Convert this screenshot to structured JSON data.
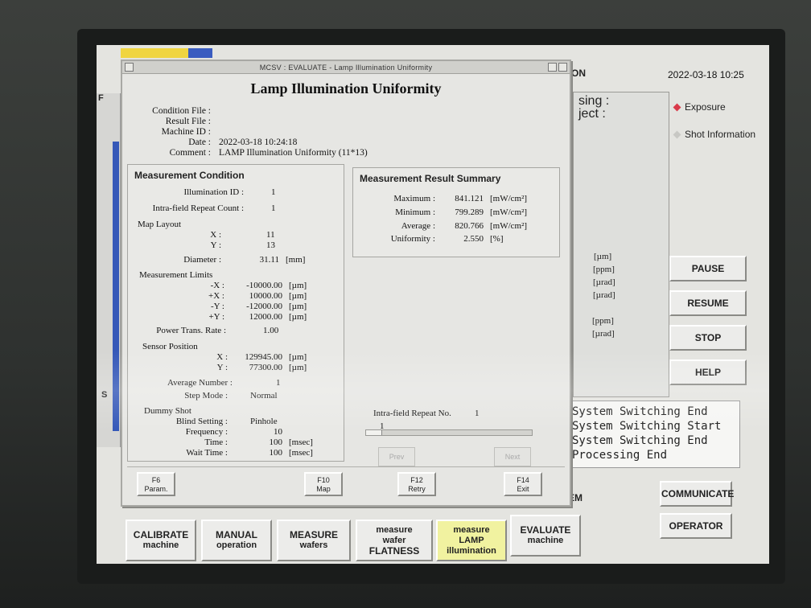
{
  "app": {
    "title_partial": "ON",
    "datetime": "2022-03-18 10:25",
    "panel_labels": [
      "sing :",
      "ject :"
    ],
    "units": [
      "[µm]",
      "[ppm]",
      "[µrad]",
      "[µrad]",
      "[ppm]",
      "[µrad]"
    ],
    "side_options": [
      {
        "label": "Exposure",
        "color": "#d93a4a"
      },
      {
        "label": "Shot Information",
        "color": "#c8c8c4"
      }
    ],
    "side_buttons": [
      "PAUSE",
      "RESUME",
      "STOP",
      "HELP"
    ],
    "log_lines": [
      "System Switching End",
      "System Switching Start",
      "System Switching End",
      " Processing End"
    ],
    "em_label": "EM",
    "right_buttons": [
      "COMMUNICATE",
      "OPERATOR"
    ],
    "left_strip_labels": [
      "F",
      "S"
    ],
    "bottom_buttons": [
      {
        "line1": "CALIBRATE",
        "line2": "machine"
      },
      {
        "line1": "MANUAL",
        "line2": "operation"
      },
      {
        "line1": "MEASURE",
        "line2": "wafers"
      },
      {
        "line1": "measure",
        "line2": "wafer",
        "line3": "FLATNESS"
      },
      {
        "line1": "measure",
        "line2": "LAMP",
        "line3": "illumination"
      },
      {
        "line1": "EVALUATE",
        "line2": "machine"
      }
    ]
  },
  "dialog": {
    "window_title": "MCSV : EVALUATE - Lamp Illumination Uniformity",
    "heading": "Lamp Illumination Uniformity",
    "meta": [
      {
        "k": "Condition File :",
        "v": ""
      },
      {
        "k": "Result File :",
        "v": ""
      },
      {
        "k": "Machine ID :",
        "v": ""
      },
      {
        "k": "Date :",
        "v": "2022-03-18 10:24:18"
      },
      {
        "k": "Comment :",
        "v": "LAMP Illumination Uniformity (11*13)"
      }
    ],
    "condition": {
      "title": "Measurement Condition",
      "illumination_id_label": "Illumination ID :",
      "illumination_id": "1",
      "repeat_count_label": "Intra-field Repeat Count :",
      "repeat_count": "1",
      "map_layout_label": "Map Layout",
      "x_label": "X :",
      "map_x": "11",
      "y_label": "Y :",
      "map_y": "13",
      "diameter_label": "Diameter :",
      "diameter": "31.11",
      "diameter_unit": "[mm]",
      "limits_label": "Measurement Limits",
      "limits": [
        {
          "k": "-X :",
          "v": "-10000.00",
          "u": "[µm]"
        },
        {
          "k": "+X :",
          "v": "10000.00",
          "u": "[µm]"
        },
        {
          "k": "-Y :",
          "v": "-12000.00",
          "u": "[µm]"
        },
        {
          "k": "+Y :",
          "v": "12000.00",
          "u": "[µm]"
        }
      ],
      "power_label": "Power Trans. Rate :",
      "power": "1.00",
      "sensor_label": "Sensor Position",
      "sensor": [
        {
          "k": "X :",
          "v": "129945.00",
          "u": "[µm]"
        },
        {
          "k": "Y :",
          "v": "77300.00",
          "u": "[µm]"
        }
      ],
      "avg_label": "Average Number :",
      "avg": "1",
      "step_label": "Step Mode :",
      "step": "Normal",
      "dummy_label": "Dummy Shot",
      "dummy": [
        {
          "k": "Blind Setting :",
          "v": "Pinhole",
          "u": ""
        },
        {
          "k": "Frequency :",
          "v": "10",
          "u": ""
        },
        {
          "k": "Time :",
          "v": "100",
          "u": "[msec]"
        },
        {
          "k": "Wait Time :",
          "v": "100",
          "u": "[msec]"
        }
      ]
    },
    "result": {
      "title": "Measurement Result Summary",
      "rows": [
        {
          "k": "Maximum :",
          "v": "841.121",
          "u": "[mW/cm²]"
        },
        {
          "k": "Minimum :",
          "v": "799.289",
          "u": "[mW/cm²]"
        },
        {
          "k": "Average :",
          "v": "820.766",
          "u": "[mW/cm²]"
        },
        {
          "k": "Uniformity :",
          "v": "2.550",
          "u": "[%]"
        }
      ]
    },
    "repeat": {
      "label": "Intra-field Repeat No.",
      "value": "1",
      "slider_value": "1"
    },
    "nav": {
      "prev": "Prev",
      "next": "Next"
    },
    "fkeys": [
      {
        "key": "F6",
        "label": "Param."
      },
      {
        "key": "F10",
        "label": "Map"
      },
      {
        "key": "F12",
        "label": "Retry"
      },
      {
        "key": "F14",
        "label": "Exit"
      }
    ]
  }
}
